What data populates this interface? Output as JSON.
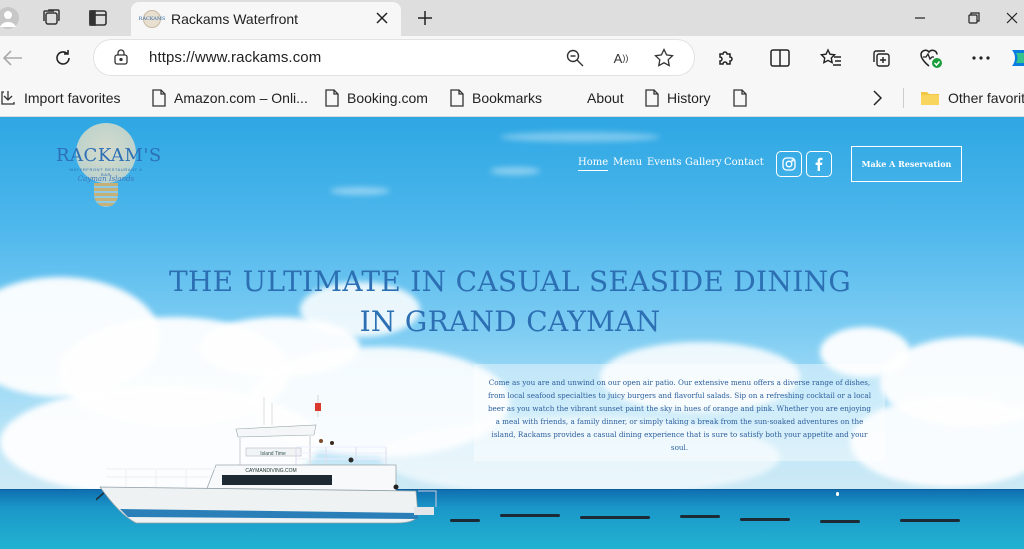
{
  "browser": {
    "tab": {
      "title": "Rackams Waterfront",
      "favicon_text": "RACKAMS"
    },
    "url": "https://www.rackams.com",
    "favorites": [
      {
        "label": "Import favorites",
        "icon": "import-icon"
      },
      {
        "label": "Amazon.com – Onli...",
        "icon": "page-icon"
      },
      {
        "label": "Booking.com",
        "icon": "page-icon"
      },
      {
        "label": "Bookmarks",
        "icon": "page-icon"
      },
      {
        "label": "About",
        "icon": ""
      },
      {
        "label": "History",
        "icon": "page-icon"
      },
      {
        "label": "Other favorit",
        "icon": "folder-icon"
      }
    ],
    "reader_icon_text": "A",
    "accent_color": "#0a7be0",
    "heart_status_color": "#1a9e3b"
  },
  "site": {
    "logo": {
      "name": "RACKAM'S",
      "subtitle": "WATERFRONT RESTAURANT & BAR",
      "script": "Cayman Islands"
    },
    "nav": [
      "Home",
      "Menu",
      "Events",
      "Gallery",
      "Contact"
    ],
    "social": [
      {
        "icon": "instagram-icon"
      },
      {
        "icon": "facebook-icon"
      }
    ],
    "reserve_label": "Make A Reservation",
    "headline": "THE ULTIMATE IN CASUAL SEASIDE DINING IN GRAND CAYMAN",
    "intro": "Come as you are and unwind on our open air patio. Our extensive menu offers a diverse range of dishes, from local seafood specialties to juicy burgers and flavorful salads. Sip on a refreshing cocktail or a local beer as you watch the vibrant sunset paint the sky in hues of orange and pink. Whether you are enjoying a meal with friends, a family dinner, or simply taking a break from the sun-soaked adventures on the island, Rackams provides a casual dining experience that is sure to satisfy both your appetite and your soul.",
    "boat": {
      "name": "Island Time",
      "website": "CAYMANDIVING.COM"
    },
    "colors": {
      "headline": "#2c6fb3",
      "sky": "#2ea7e3",
      "sea": "#1a97c9"
    }
  }
}
